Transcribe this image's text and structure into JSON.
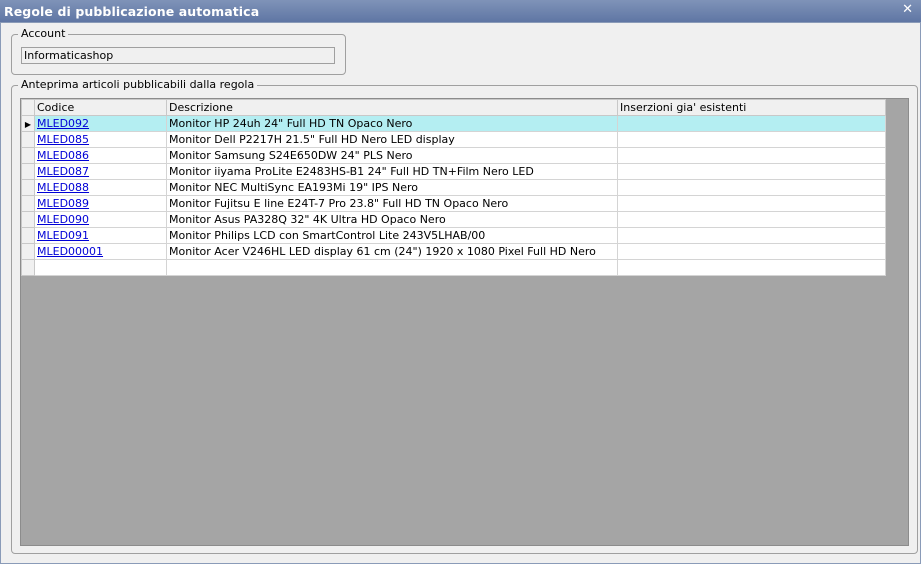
{
  "window": {
    "title": "Regole di pubblicazione automatica",
    "close_glyph": "✕"
  },
  "account": {
    "legend": "Account",
    "value": "Informaticashop"
  },
  "preview": {
    "legend": "Anteprima articoli pubblicabili dalla regola",
    "columns": {
      "codice": "Codice",
      "descrizione": "Descrizione",
      "inserzioni": "Inserzioni gia' esistenti"
    },
    "rows": [
      {
        "codice": "MLED092",
        "descrizione": "Monitor HP 24uh 24\" Full HD TN Opaco Nero",
        "inserzioni": ""
      },
      {
        "codice": "MLED085",
        "descrizione": "Monitor Dell P2217H 21.5\" Full HD Nero LED display",
        "inserzioni": ""
      },
      {
        "codice": "MLED086",
        "descrizione": "Monitor Samsung S24E650DW 24\" PLS Nero",
        "inserzioni": ""
      },
      {
        "codice": "MLED087",
        "descrizione": "Monitor iiyama ProLite E2483HS-B1 24\" Full HD TN+Film Nero LED",
        "inserzioni": ""
      },
      {
        "codice": "MLED088",
        "descrizione": "Monitor NEC MultiSync EA193Mi 19\" IPS Nero",
        "inserzioni": ""
      },
      {
        "codice": "MLED089",
        "descrizione": "Monitor Fujitsu E line E24T-7 Pro 23.8\" Full HD TN Opaco Nero",
        "inserzioni": ""
      },
      {
        "codice": "MLED090",
        "descrizione": "Monitor Asus PA328Q 32\" 4K Ultra HD Opaco Nero",
        "inserzioni": ""
      },
      {
        "codice": "MLED091",
        "descrizione": "Monitor Philips LCD con SmartControl Lite 243V5LHAB/00",
        "inserzioni": ""
      },
      {
        "codice": "MLED00001",
        "descrizione": "Monitor Acer V246HL LED display 61 cm (24\") 1920 x 1080 Pixel Full HD Nero",
        "inserzioni": ""
      }
    ],
    "current_row_glyph": "▶"
  },
  "colors": {
    "titlebar": "#6f84ae",
    "selected_row": "#b4eef2",
    "grid_background": "#a5a5a5",
    "link": "#0000d6"
  },
  "icons": {
    "close": "close-icon",
    "row_indicator": "current-row-arrow-icon"
  }
}
